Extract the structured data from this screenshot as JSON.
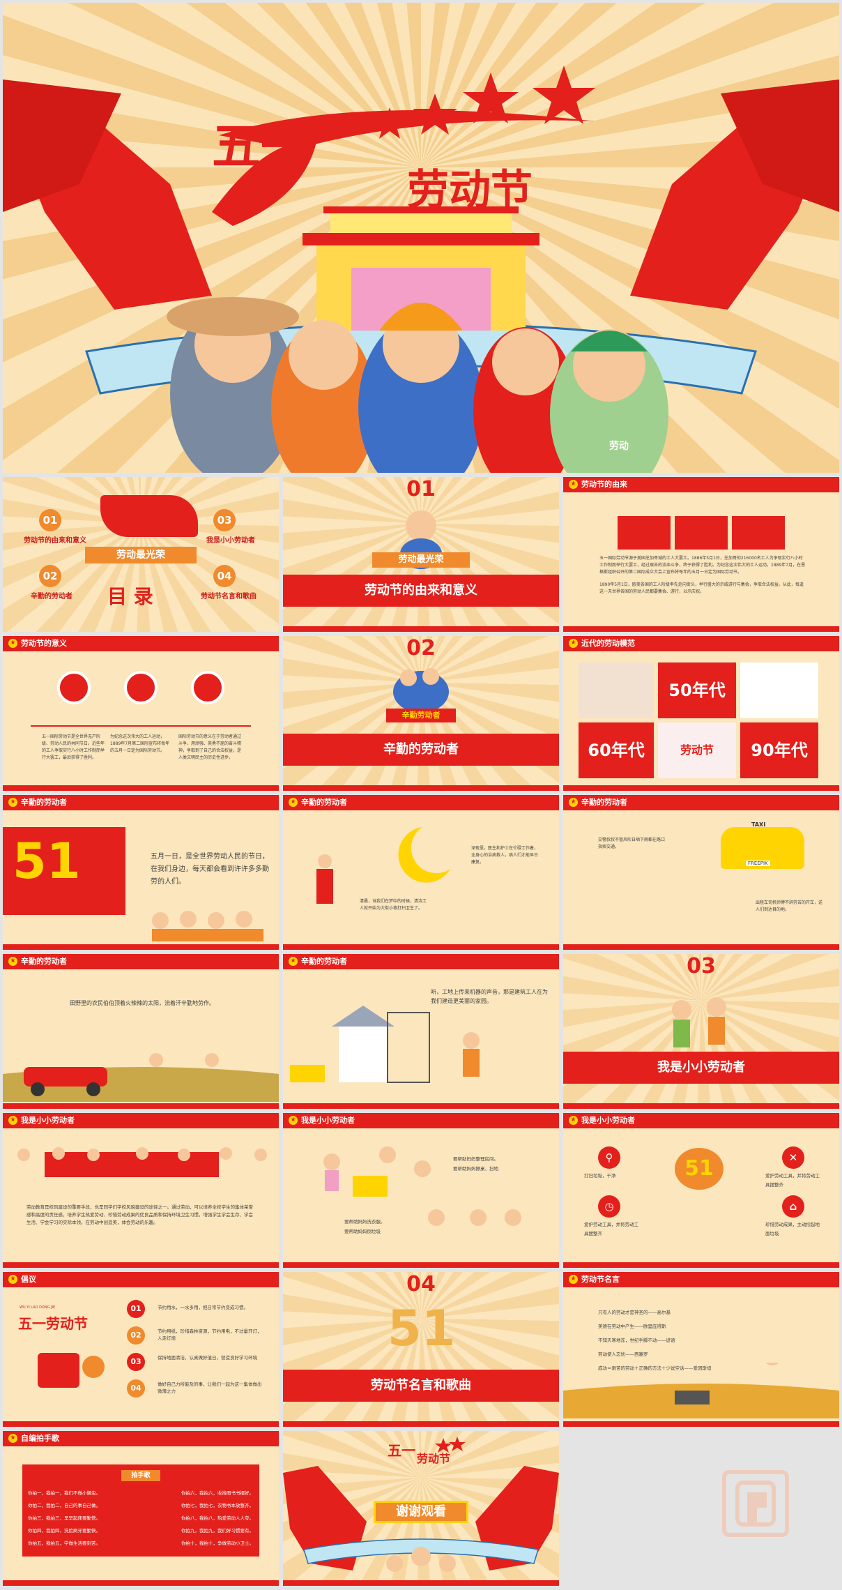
{
  "cover": {
    "title_digit": "五一",
    "title": "劳动节",
    "badge": "劳动"
  },
  "slides": {
    "s2": {
      "items": [
        {
          "num": "01",
          "label": "劳动节的由来和意义"
        },
        {
          "num": "02",
          "label": "辛勤的劳动者"
        },
        {
          "num": "03",
          "label": "我是小小劳动者"
        },
        {
          "num": "04",
          "label": "劳动节名言和歌曲"
        }
      ],
      "ribbon": "劳动最光荣",
      "heading": "目 录"
    },
    "s3": {
      "num": "01",
      "ribbon": "劳动最光荣",
      "title": "劳动节的由来和意义"
    },
    "s4": {
      "header": "劳动节的由来",
      "para1": "五一国际劳动节源于美国芝加哥城的工人大罢工。1886年5月1日，芝加哥的216000名工人为争取实行八小时工作制而举行大罢工，经过艰苦的流血斗争，终于获得了胜利。为纪念这次伟大的工人运动，1889年7月，在恩格斯组织召开的第二国际成立大会上宣布将每年的五月一日定为国际劳动节。",
      "para2": "1890年5月1日，欧美各国的工人阶级率先走向街头，举行盛大的示威游行与集会，争取合法权益。从此，每逢这一天世界各国的劳动人民都要集会、游行，以示庆祝。"
    },
    "s5": {
      "header": "劳动节的意义",
      "col1": "五一国际劳动节是全世界无产阶级、劳动人民的共同节日。近些年的工人争取实行八小时工作制而举行大罢工，最后获得了胜利。",
      "col2": "为纪念这次伟大的工人运动，1889年7月第二国际宣布将每年的五月一日定为国际劳动节。",
      "col3": "国际劳动节的意义在于劳动者通过斗争，用顽强、英勇不屈的奋斗精神，争取到了自己的合法权益，是人类文明民主的历史性进步。"
    },
    "s6": {
      "num": "02",
      "ribbon": "辛勤劳动者",
      "title": "辛勤的劳动者"
    },
    "s7": {
      "header": "近代的劳动模范",
      "eras": [
        "50年代",
        "60年代",
        "90年代"
      ],
      "poster": "劳动节"
    },
    "s8": {
      "header": "辛勤的劳动者",
      "text": "五月一日，是全世界劳动人民的节日，在我们身边，每天都会看到许许多多勤劳的人们。"
    },
    "s9": {
      "header": "辛勤的劳动者",
      "t1": "深夜里，医生和护士在忙碌工作着，全身心的治病救人，病人们才能早日康复。",
      "t2": "清晨，当我们在梦中的时候，清洁工人就开始为大街小巷打扫卫生了。"
    },
    "s10": {
      "header": "辛勤的劳动者",
      "t1": "交警叔叔不管风吹日晒下雨都在路口指挥交通。",
      "t2": "出租车司机师傅不辞劳苦的开车，送人们到达目的地。",
      "taxi": "TAXI",
      "plate": "FREEPIK"
    },
    "s11": {
      "header": "辛勤的劳动者",
      "text": "田野里的农民伯伯顶着火辣辣的太阳，流着汗辛勤地劳作。"
    },
    "s12": {
      "header": "辛勤的劳动者",
      "text": "听，工地上传来机器的声音，那是建筑工人在为我们建造更美丽的家园。"
    },
    "s13": {
      "num": "03",
      "title": "我是小小劳动者"
    },
    "s14": {
      "header": "我是小小劳动者",
      "text": "劳动教育是校风建设的重要手段，也是同学们学校风貌建设的途径之一。通过劳动，可以培养全校学生的集体荣誉感和高度的责任感，培养学生热爱劳动、珍惜劳动成果的优良品质和保持环境卫生习惯，增强学生学会生存、学会生活、学会学习的实际本领，在劳动中创造美，体会劳动的乐趣。"
    },
    "s15": {
      "header": "我是小小劳动者",
      "t1": "要帮助妈妈整理房间。",
      "t2": "要帮助妈妈擦桌、扫地",
      "t3": "要帮助妈妈洗衣服。",
      "t4": "要帮助妈妈倒垃圾"
    },
    "s16": {
      "header": "我是小小劳动者",
      "items": [
        "打扫垃圾，干净",
        "爱护劳动工具，并将劳动工具摆整齐",
        "爱护劳动工具，并将劳动工具摆整齐",
        "珍惜劳动成果，主动捡起地面垃圾"
      ],
      "badge": "51"
    },
    "s17": {
      "header": "倡议",
      "pinyin": "WU  YI  LAO DONG JIE",
      "title": "五一劳动节",
      "items": [
        {
          "num": "01",
          "text": "节约用水，一水多用，把日常节约变成习惯。"
        },
        {
          "num": "02",
          "text": "节约用纸，珍惜森林资源，节约用电，不过量开灯，人走灯熄"
        },
        {
          "num": "03",
          "text": "保持地面清洁，认真做好值日，营造良好学习环境"
        },
        {
          "num": "04",
          "text": "做好自己力所能及的事，让我们一起为这一集体做出微薄之力"
        }
      ]
    },
    "s18": {
      "num": "04",
      "title": "劳动节名言和歌曲"
    },
    "s19": {
      "header": "劳动节名言",
      "quotes": [
        "只有人的劳动才是神圣的——高尔基",
        "美德在劳动中产生——欧里庇得斯",
        "不知天寒地冻，世纪手脚不动——谚语",
        "劳动使人忘忧——西塞罗",
        "成功＝艰苦的劳动＋正确的方法＋少说空话——爱因斯坦"
      ]
    },
    "s20": {
      "header": "自编拍手歌",
      "panel_title": "拍手歌",
      "lines": [
        [
          "你拍一，我拍一，我们不做小懒虫。",
          "你拍六，我拍六，收拾图书书摆好。"
        ],
        [
          "你拍二，我拍二，自己的事自己做。",
          "你拍七，我拍七，衣物书本放整齐。"
        ],
        [
          "你拍三，我拍三，早早起床要勤快。",
          "你拍八，我拍八，热爱劳动人人夸。"
        ],
        [
          "你拍四，我拍四，洗脸刷牙要勤快。",
          "你拍九，我拍九，我们好习惯要有。"
        ],
        [
          "你拍五，我拍五，学做生活要刻苦。",
          "你拍十，我拍十，争做劳动小卫士。"
        ]
      ]
    },
    "s21": {
      "title_digit": "五一",
      "title": "劳动节",
      "thanks": "谢谢观看"
    }
  },
  "colors": {
    "red": "#e3201b",
    "orange": "#f08a2c",
    "cream": "#fbe6bd",
    "gold": "#ffd400"
  }
}
